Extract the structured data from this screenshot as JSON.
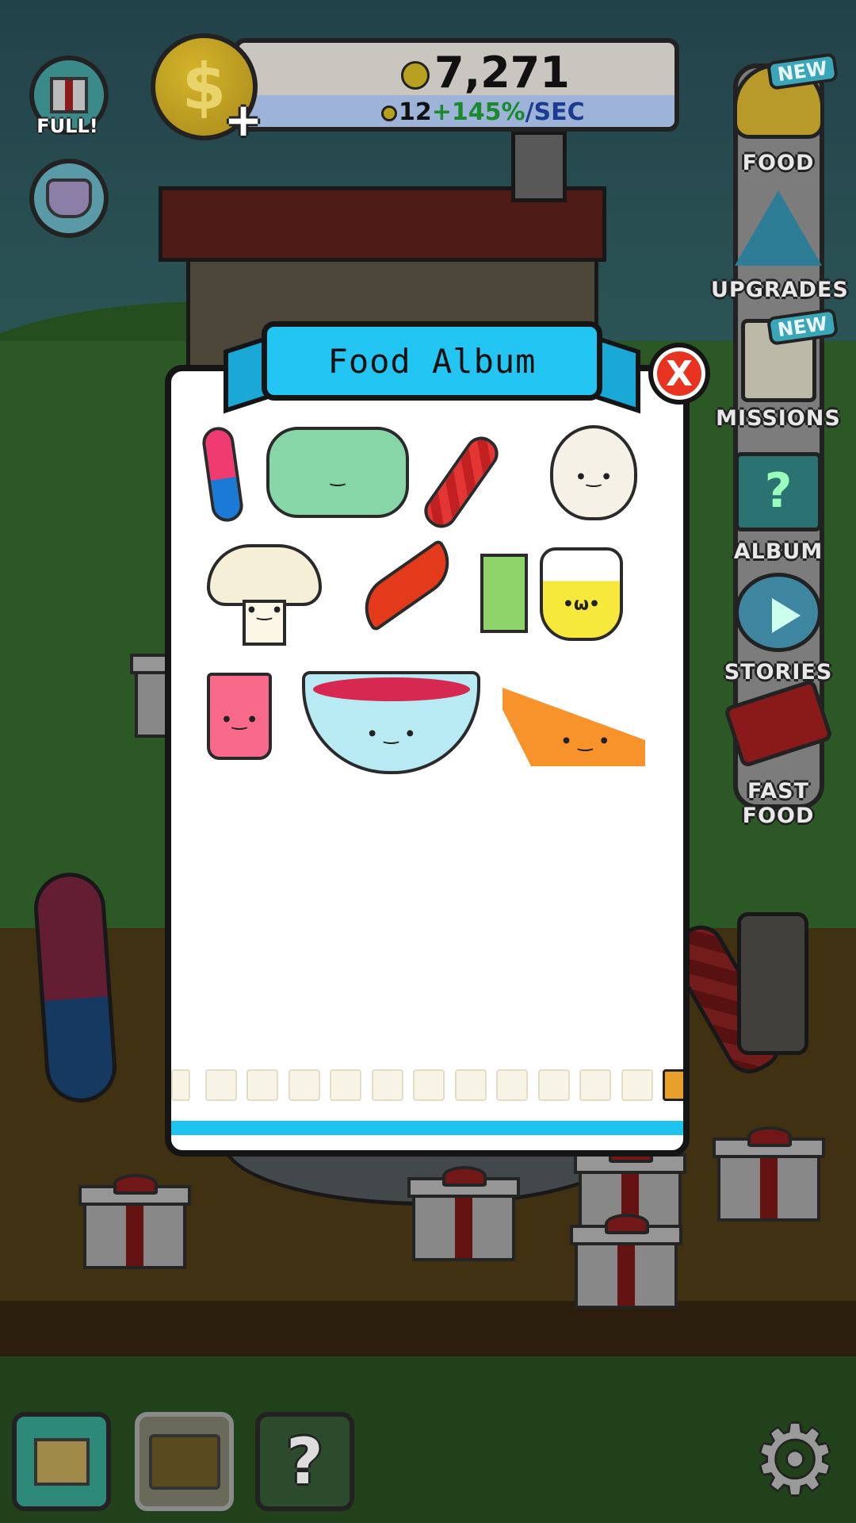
{
  "hud": {
    "coins_total": "7,271",
    "rate_base": "12",
    "rate_percent": "+145%",
    "rate_unit": "/SEC",
    "coin_symbol": "$",
    "plus_symbol": "+"
  },
  "left_buttons": {
    "gift_label": "FULL!"
  },
  "sidebar": {
    "new_badge": "NEW",
    "items": [
      {
        "label": "FOOD",
        "icon": "taco-icon",
        "new": true
      },
      {
        "label": "UPGRADES",
        "icon": "arrow-up-icon",
        "new": false
      },
      {
        "label": "MISSIONS",
        "icon": "clipboard-icon",
        "new": true
      },
      {
        "label": "ALBUM",
        "icon": "album-book-icon",
        "new": false
      },
      {
        "label": "STORIES",
        "icon": "play-bubble-icon",
        "new": false
      },
      {
        "label": "FAST FOOD",
        "icon": "truck-icon",
        "new": false
      }
    ]
  },
  "modal": {
    "title": "Food Album",
    "close_label": "X",
    "foods": [
      {
        "name": "gummy-worm",
        "face": ""
      },
      {
        "name": "paper-roll",
        "face": "‿"
      },
      {
        "name": "licorice",
        "face": ""
      },
      {
        "name": "garlic",
        "face": "•‿•"
      },
      {
        "name": "mushroom",
        "face": "•‿•"
      },
      {
        "name": "chili-pepper",
        "face": ""
      },
      {
        "name": "juice-box",
        "face": ""
      },
      {
        "name": "lemonade-pitcher",
        "face": "•ω•"
      },
      {
        "name": "milkshake",
        "face": "•‿•"
      },
      {
        "name": "berry-bowl",
        "face": "• ‿ •"
      },
      {
        "name": "pumpkin-pie",
        "face": "• ‿ •"
      }
    ],
    "thumbnail_count": 13,
    "active_thumbnail": 13
  },
  "bottom_bar": {
    "help_symbol": "?",
    "settings_symbol": "⚙"
  },
  "colors": {
    "ribbon": "#23c6f2",
    "close": "#e83320",
    "rate_percent": "#1b8a2c",
    "rate_unit": "#1c3d8f"
  }
}
